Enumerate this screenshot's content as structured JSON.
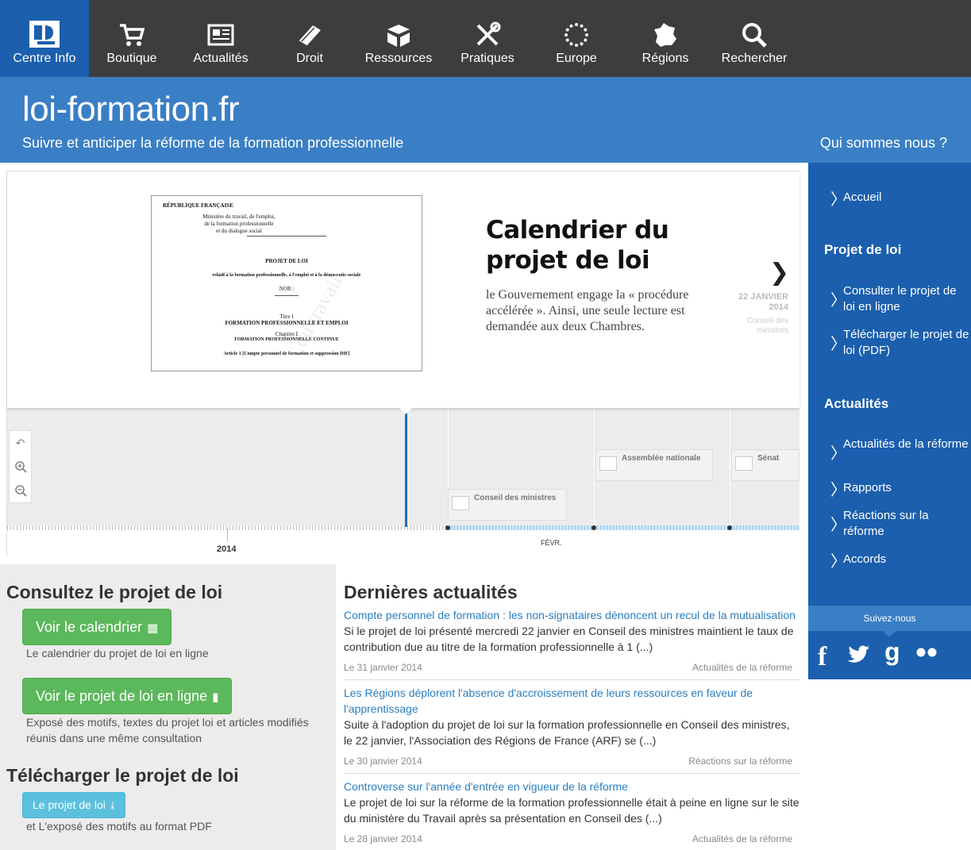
{
  "nav": {
    "items": [
      {
        "label": "Centre Info",
        "icon": "centre-info-logo-icon",
        "active": true
      },
      {
        "label": "Boutique",
        "icon": "cart-icon"
      },
      {
        "label": "Actualités",
        "icon": "newspaper-icon"
      },
      {
        "label": "Droit",
        "icon": "book-icon"
      },
      {
        "label": "Ressources",
        "icon": "box-icon"
      },
      {
        "label": "Pratiques",
        "icon": "tools-icon"
      },
      {
        "label": "Europe",
        "icon": "eu-stars-icon"
      },
      {
        "label": "Régions",
        "icon": "france-map-icon"
      },
      {
        "label": "Rechercher",
        "icon": "search-icon"
      }
    ]
  },
  "header": {
    "title": "loi-formation.fr",
    "tagline": "Suivre et anticiper la réforme de la formation professionnelle",
    "about": "Qui sommes nous ?"
  },
  "slide": {
    "doc": {
      "l1": "RÉPUBLIQUE FRANÇAISE",
      "l2": "Ministère du travail, de l'emploi,",
      "l3": "de la formation professionnelle",
      "l4": "et du dialogue social",
      "l5": "PROJET DE LOI",
      "l6": "relatif à la formation professionnelle, à l'emploi et à la démocratie sociale",
      "l7": "NOR :",
      "l8": "Titre I",
      "l9": "FORMATION PROFESSIONNELLE ET EMPLOI",
      "l10": "Chapitre I",
      "l11": "FORMATION PROFESSIONNELLE CONTINUE",
      "l12": "Article 1 [Compte personnel de formation et suppression DIF]",
      "watermark": "du travail"
    },
    "title": "Calendrier du projet de loi",
    "text": "le Gouvernement engage la « procédure accélérée ». Ainsi, une seule lecture est demandée aux deux Chambres.",
    "date": "22 JANVIER 2014",
    "date_sub": "Conseil des ministres"
  },
  "timeline": {
    "events": [
      {
        "label": "Conseil des ministres"
      },
      {
        "label": "Assemblée nationale"
      },
      {
        "label": "Sénat"
      }
    ],
    "ruler": {
      "year": "2014",
      "month": "FÉVR."
    }
  },
  "sidebar": {
    "accueil": "Accueil",
    "head_projet": "Projet de loi",
    "consulter": "Consulter le projet de loi en ligne",
    "telecharger": "Télécharger le projet de loi (PDF)",
    "head_actu": "Actualités",
    "actu_reforme": "Actualités de la réforme",
    "rapports": "Rapports",
    "reactions": "Réactions sur la réforme",
    "accords": "Accords",
    "follow": "Suivez-nous"
  },
  "left_panel": {
    "h1": "Consultez le projet de loi",
    "btn_calendar": "Voir le calendrier",
    "note_calendar": "Le calendrier du projet de loi en ligne",
    "btn_online": "Voir le projet de loi en ligne",
    "note_online": "Exposé des motifs, textes du projet loi et articles modifiés réunis dans une même consultation",
    "h2": "Télécharger le projet de loi",
    "btn_pdf": "Le projet de loi",
    "note_pdf": "et L'exposé des motifs au format PDF"
  },
  "news": {
    "heading": "Dernières actualités",
    "items": [
      {
        "title": "Compte personnel de formation : les non-signataires dénoncent un recul de la mutualisation",
        "body": "Si le projet de loi présenté mercredi 22 janvier en Conseil des ministres maintient le taux de contribution due au titre de la formation professionnelle à 1 (...)",
        "date": "Le 31 janvier 2014",
        "category": "Actualités de la réforme"
      },
      {
        "title": "Les Régions déplorent l'absence d'accroissement de leurs ressources en faveur de l'apprentissage",
        "body": "Suite à l'adoption du projet de loi sur la formation professionnelle en Conseil des ministres, le 22 janvier, l'Association des Régions de France (ARF) se (...)",
        "date": "Le 30 janvier 2014",
        "category": "Réactions sur la réforme"
      },
      {
        "title": "Controverse sur l'année d'entrée en vigueur de la réforme",
        "body": "Le projet de loi sur la réforme de la formation professionnelle était à peine en ligne sur le site du ministère du Travail après sa présentation en Conseil des (...)",
        "date": "Le 28 janvier 2014",
        "category": "Actualités de la réforme"
      }
    ]
  },
  "colors": {
    "nav_bg": "#3d3d3d",
    "brand_dark_blue": "#1b5fae",
    "header_blue": "#3a7fc5",
    "link_blue": "#2a7ec2",
    "btn_green": "#5cb85c",
    "btn_blue": "#5bc0de"
  }
}
